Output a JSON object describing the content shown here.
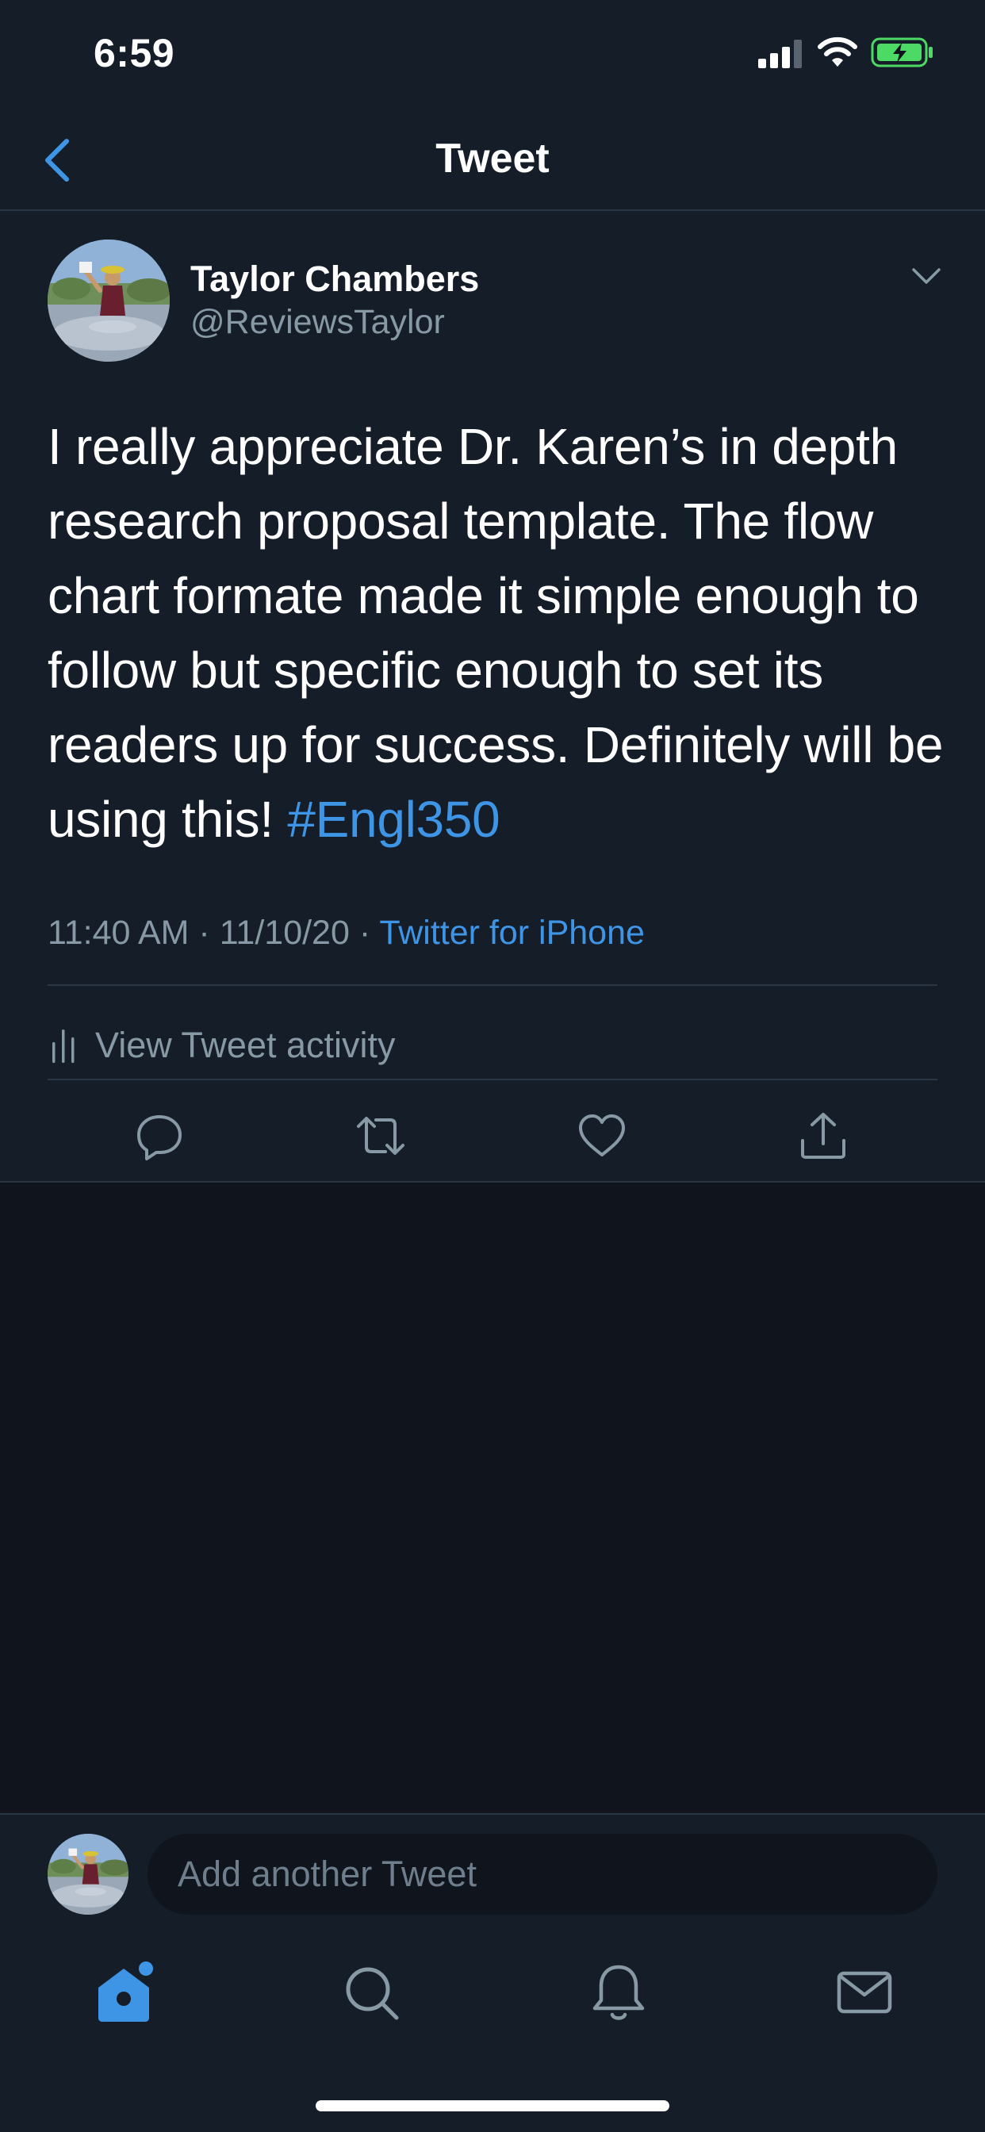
{
  "status_bar": {
    "time": "6:59"
  },
  "header": {
    "title": "Tweet",
    "back_icon": "chevron-left-icon"
  },
  "tweet": {
    "author": {
      "name": "Taylor Chambers",
      "handle": "@ReviewsTaylor"
    },
    "text_before_hashtag": "I really appreciate Dr. Karen’s in depth research proposal template. The flow chart formate made it simple enough to follow but specific enough to set its readers up for success. Definitely will be using this! ",
    "hashtag": "#Engl350",
    "timestamp": "11:40 AM · 11/10/20 · ",
    "source": "Twitter for iPhone",
    "activity_label": "View Tweet activity",
    "actions": [
      "reply-icon",
      "retweet-icon",
      "like-icon",
      "share-icon"
    ]
  },
  "reply_bar": {
    "placeholder": "Add another Tweet"
  },
  "tab_bar": {
    "tabs": [
      "home-icon",
      "search-icon",
      "notifications-icon",
      "messages-icon"
    ]
  },
  "colors": {
    "background": "#10151d",
    "surface": "#151d28",
    "accent": "#3e95e6",
    "secondary_text": "#8899a6",
    "divider": "#2b3644",
    "battery": "#4cd964"
  }
}
